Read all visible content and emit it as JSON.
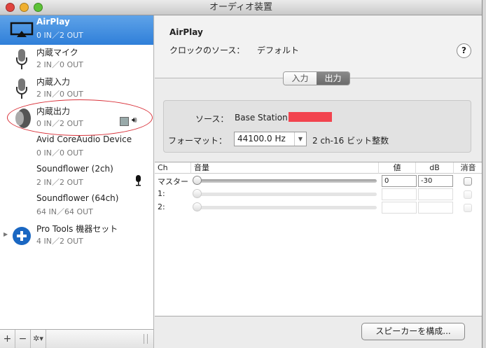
{
  "window": {
    "title": "オーディオ装置"
  },
  "devices": [
    {
      "name": "AirPlay",
      "io": "0 IN／2 OUT",
      "icon": "airplay-icon",
      "selected": true
    },
    {
      "name": "内蔵マイク",
      "io": "2 IN／0 OUT",
      "icon": "microphone-icon"
    },
    {
      "name": "内蔵入力",
      "io": "2 IN／0 OUT",
      "icon": "microphone-icon"
    },
    {
      "name": "内蔵出力",
      "io": "0 IN／2 OUT",
      "icon": "speaker-icon"
    },
    {
      "name": "Avid CoreAudio Device",
      "io": "0 IN／0 OUT"
    },
    {
      "name": "Soundflower (2ch)",
      "io": "2 IN／2 OUT"
    },
    {
      "name": "Soundflower (64ch)",
      "io": "64 IN／64 OUT"
    },
    {
      "name": "Pro Tools 機器セット",
      "io": "4 IN／2 OUT",
      "icon": "aggregate-plus-icon"
    }
  ],
  "sidebar_bar": {
    "add": "+",
    "remove": "−",
    "gear": "✲▾"
  },
  "detail": {
    "title": "AirPlay",
    "clock_label": "クロックのソース：",
    "clock_value": "デフォルト",
    "help": "?",
    "tabs": [
      {
        "label": "入力"
      },
      {
        "label": "出力",
        "active": true
      }
    ],
    "source_label": "ソース：",
    "source_value": "Base Station",
    "format_label": "フォーマット：",
    "format_value": "44100.0 Hz",
    "format_desc": "2 ch-16 ビット整数"
  },
  "table": {
    "headers": {
      "ch": "Ch",
      "volume": "音量",
      "value": "値",
      "db": "dB",
      "mute": "消音"
    },
    "rows": [
      {
        "ch": "マスター",
        "value": "0",
        "db": "-30",
        "volume": 0
      },
      {
        "ch": "1:",
        "value": "",
        "db": ""
      },
      {
        "ch": "2:",
        "value": "",
        "db": ""
      }
    ]
  },
  "configure_button": "スピーカーを構成...",
  "colors": {
    "selection": "#2f7fd9",
    "redaction": "#f2444f",
    "annotation": "#d9323a"
  }
}
